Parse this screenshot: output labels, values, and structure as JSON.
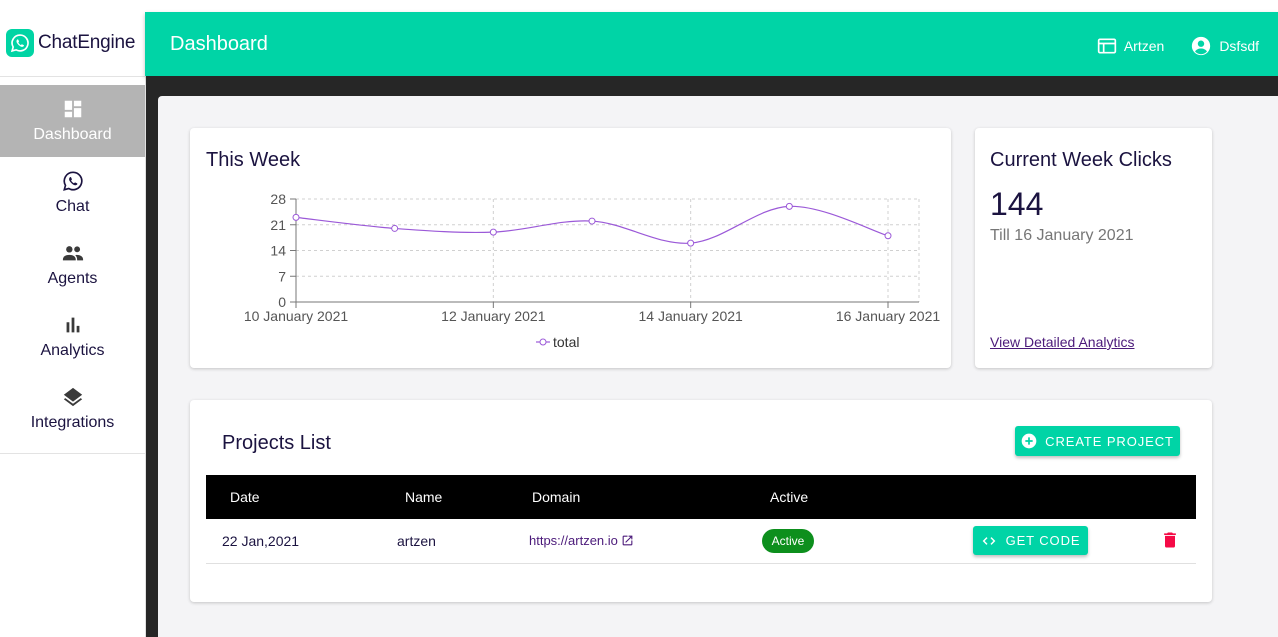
{
  "brand": {
    "name": "ChatEngine",
    "accent": "#00d4a6"
  },
  "sidebar": {
    "items": [
      {
        "label": "Dashboard",
        "icon": "dashboard-icon",
        "active": true
      },
      {
        "label": "Chat",
        "icon": "whatsapp-icon",
        "active": false
      },
      {
        "label": "Agents",
        "icon": "people-icon",
        "active": false
      },
      {
        "label": "Analytics",
        "icon": "bar-chart-icon",
        "active": false
      },
      {
        "label": "Integrations",
        "icon": "layers-icon",
        "active": false
      }
    ]
  },
  "header": {
    "title": "Dashboard",
    "workspace": "Artzen",
    "user": "Dsfsdf"
  },
  "week_card": {
    "title": "This Week",
    "legend": "total"
  },
  "chart_data": {
    "type": "line",
    "x": [
      "10 January 2021",
      "11 January 2021",
      "12 January 2021",
      "13 January 2021",
      "14 January 2021",
      "15 January 2021",
      "16 January 2021"
    ],
    "x_ticks": [
      "10 January 2021",
      "12 January 2021",
      "14 January 2021",
      "16 January 2021"
    ],
    "series": [
      {
        "name": "total",
        "values": [
          23,
          20,
          19,
          22,
          16,
          26,
          18
        ],
        "color": "#9b59d8"
      }
    ],
    "yticks": [
      0,
      7,
      14,
      21,
      28
    ],
    "ylim": [
      0,
      28
    ],
    "grid": true,
    "legend_position": "bottom"
  },
  "clicks_card": {
    "title": "Current Week Clicks",
    "value": "144",
    "subtitle": "Till 16 January 2021",
    "link": "View Detailed Analytics"
  },
  "projects": {
    "title": "Projects List",
    "create_label": "CREATE PROJECT",
    "columns": [
      "Date",
      "Name",
      "Domain",
      "Active"
    ],
    "rows": [
      {
        "date": "22 Jan,2021",
        "name": "artzen",
        "domain": "https://artzen.io",
        "status": "Active",
        "action_label": "GET CODE"
      }
    ]
  }
}
